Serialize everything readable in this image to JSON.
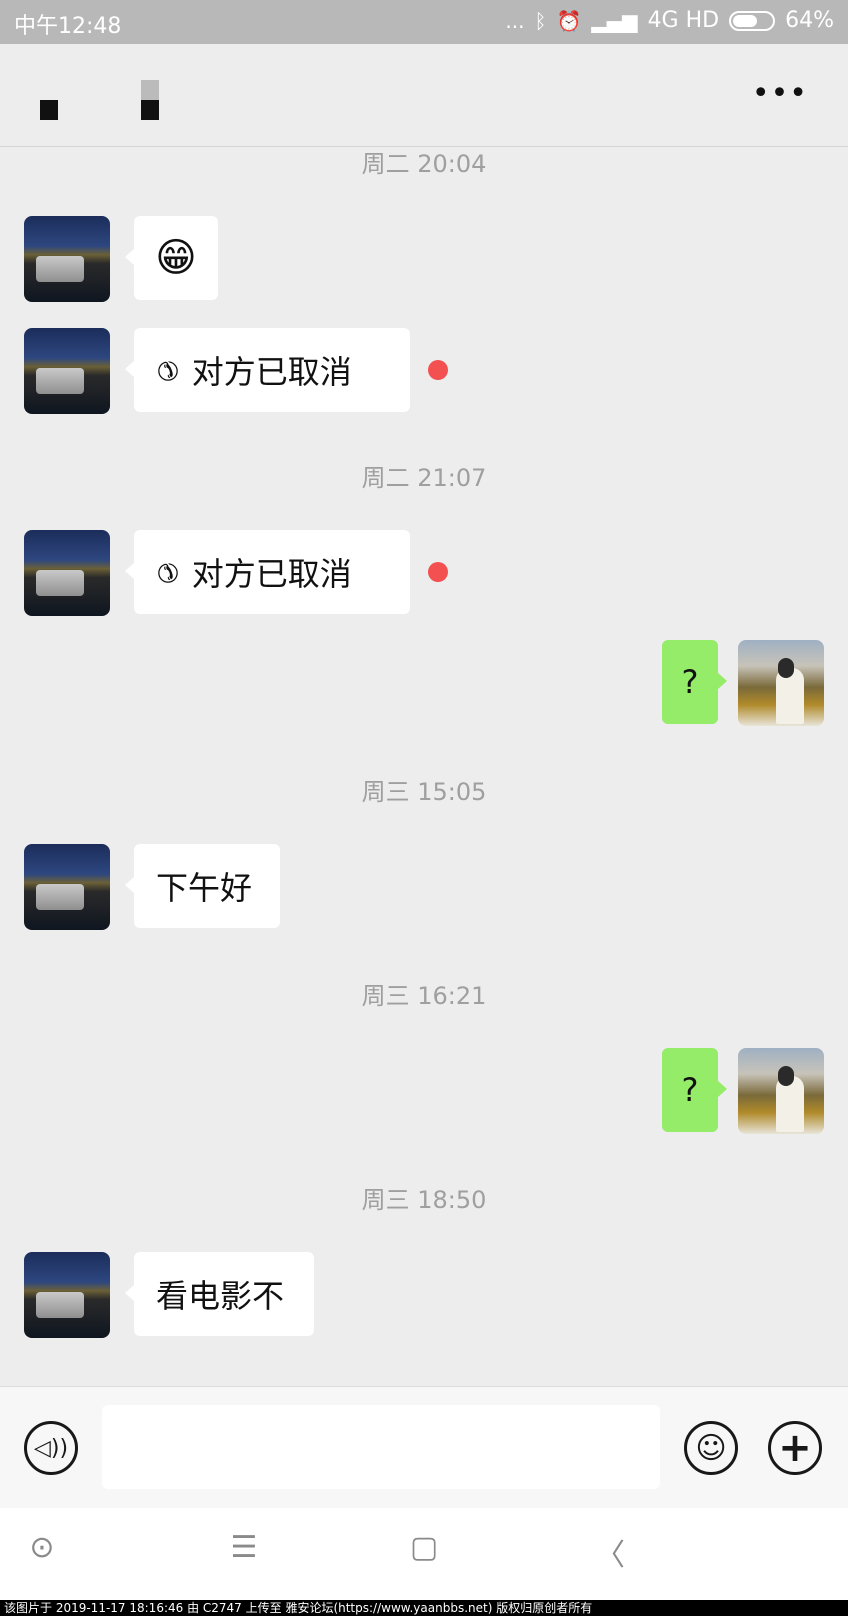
{
  "status_bar": {
    "time": "中午12:48",
    "dots": "...",
    "bluetooth_icon": "bluetooth-icon",
    "alarm_icon": "alarm-icon",
    "network": "4G HD",
    "battery": "64%",
    "battery_level": 0.64
  },
  "header": {
    "more_label": "•••"
  },
  "timestamps": [
    "周二 20:04",
    "周二 21:07",
    "周三 15:05",
    "周三 16:21",
    "周三 18:50"
  ],
  "messages": {
    "m1": "😁",
    "m2": "对方已取消",
    "m3": "对方已取消",
    "m4": "?",
    "m5": "下午好",
    "m6": "?",
    "m7": "看电影不"
  },
  "input_bar": {
    "voice_glyph": "◁))",
    "emoji_glyph": "☺",
    "plus_glyph": "+",
    "placeholder": ""
  },
  "nav": {
    "home_glyph": "⊙",
    "menu_glyph": "☰",
    "square_glyph": "▢",
    "back_glyph": "〈"
  },
  "watermark": "该图片于 2019-11-17 18:16:46 由 C2747 上传至 雅安论坛(https://www.yaanbbs.net) 版权归原创者所有",
  "colors": {
    "bubble_self": "#95ec69",
    "bubble_other": "#ffffff",
    "unread_dot": "#f35151",
    "background": "#ededed"
  }
}
